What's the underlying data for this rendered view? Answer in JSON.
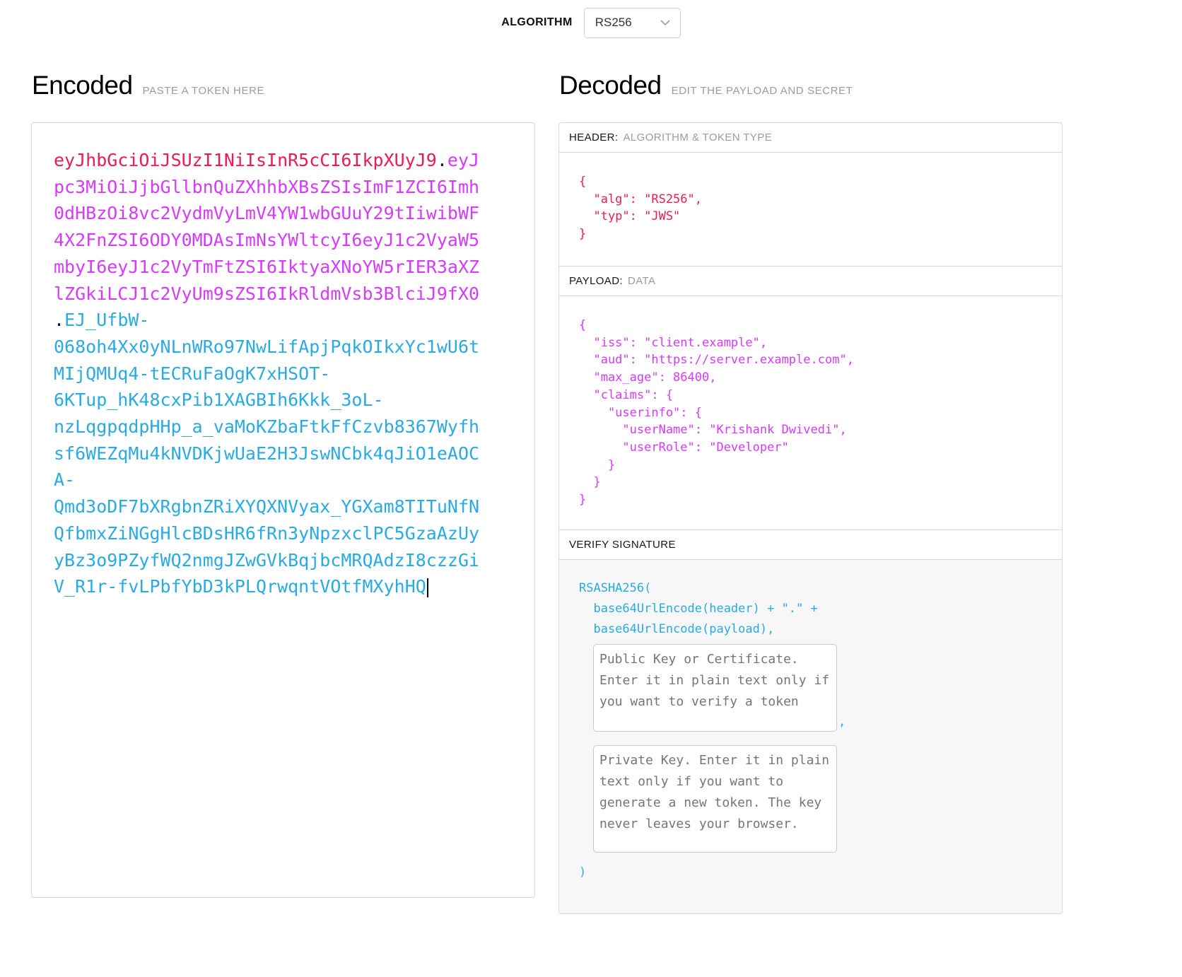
{
  "toolbar": {
    "algorithm_label": "ALGORITHM",
    "algorithm_value": "RS256"
  },
  "encoded": {
    "title": "Encoded",
    "subtitle": "PASTE A TOKEN HERE",
    "token": {
      "header": "eyJhbGciOiJSUzI1NiIsInR5cCI6IkpXUyJ9",
      "separator1": ".",
      "payload": "eyJpc3MiOiJjbGllbnQuZXhhbXBsZSIsImF1ZCI6Imh0dHBzOi8vc2VydmVyLmV4YW1wbGUuY29tIiwibWF4X2FnZSI6ODY0MDAsImNsYWltcyI6eyJ1c2VyaW5mbyI6eyJ1c2VyTmFtZSI6IktyaXNoYW5rIER3aXZlZGkiLCJ1c2VyUm9sZSI6IkRldmVsb3BlciJ9fX0",
      "separator2": ".",
      "signature": "EJ_UfbW-068oh4Xx0yNLnWRo97NwLifApjPqkOIkxYc1wU6tMIjQMUq4-tECRuFaOgK7xHSOT-6KTup_hK48cxPib1XAGBIh6Kkk_3oL-nzLqgpqdpHHp_a_vaMoKZbaFtkFfCzvb8367Wyfhsf6WEZqMu4kNVDKjwUaE2H3JswNCbk4qJiO1eAOCA-Qmd3oDF7bXRgbnZRiXYQXNVyax_YGXam8TITuNfNQfbmxZiNGgHlcBDsHR6fRn3yNpzxclPC5GzaAzUyyBz3o9PZyfWQ2nmgJZwGVkBqjbcMRQAdzI8czzGiV_R1r-fvLPbfYbD3kPLQrwqntVOtfMXyhHQ"
    }
  },
  "decoded": {
    "title": "Decoded",
    "subtitle": "EDIT THE PAYLOAD AND SECRET",
    "header_section": {
      "label": "HEADER:",
      "sublabel": "ALGORITHM & TOKEN TYPE",
      "json": "{\n  \"alg\": \"RS256\",\n  \"typ\": \"JWS\"\n}"
    },
    "payload_section": {
      "label": "PAYLOAD:",
      "sublabel": "DATA",
      "json": "{\n  \"iss\": \"client.example\",\n  \"aud\": \"https://server.example.com\",\n  \"max_age\": 86400,\n  \"claims\": {\n    \"userinfo\": {\n      \"userName\": \"Krishank Dwivedi\",\n      \"userRole\": \"Developer\"\n    }\n  }\n}"
    },
    "signature_section": {
      "label": "VERIFY SIGNATURE",
      "code_top": "RSASHA256(\n  base64UrlEncode(header) + \".\" +\n  base64UrlEncode(payload),",
      "public_key_placeholder": "Public Key or Certificate. Enter it in plain text only if you want to verify a token",
      "comma": ",",
      "private_key_placeholder": "Private Key. Enter it in plain text only if you want to generate a new token. The key never leaves your browser.",
      "code_close": ")"
    }
  },
  "colors": {
    "token_header": "#ed1b53",
    "token_payload": "#d63aff",
    "token_signature": "#29abe2",
    "panel_border": "#d8d8d8",
    "verify_background": "#f7f7f7",
    "subtitle_gray": "#9b9b9b"
  }
}
